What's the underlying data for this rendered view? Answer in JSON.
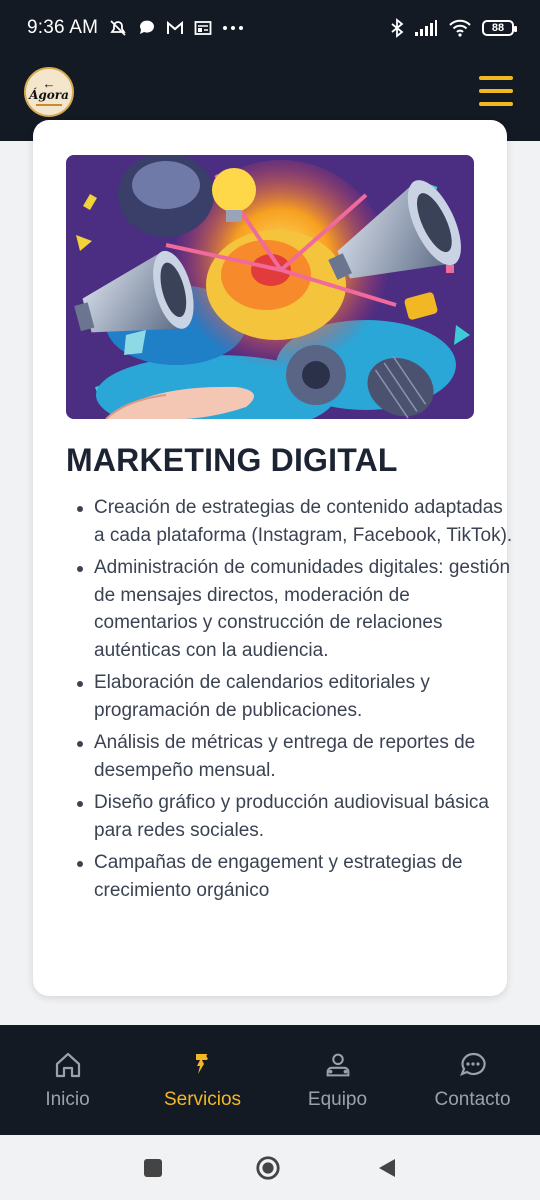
{
  "status_bar": {
    "time": "9:36 AM",
    "left_icons": [
      "mute-icon",
      "chat-bubble-icon",
      "gmail-icon",
      "news-icon",
      "more-dots-icon"
    ],
    "right_icons": [
      "bluetooth-icon",
      "signal-icon",
      "wifi-icon"
    ],
    "battery": "88"
  },
  "header": {
    "logo_text": "Ágora",
    "menu_icon": "hamburger-menu-icon",
    "accent_color": "#f2b824"
  },
  "card": {
    "image_icon": "marketing-megaphones-illustration",
    "title": "MARKETING DIGITAL",
    "features": [
      "Creación de estrategias de contenido adaptadas a cada plataforma (Instagram, Facebook, TikTok).",
      "Administración de comunidades digitales: gestión de mensajes directos, moderación de comentarios y construcción de relaciones auténticas con la audiencia.",
      "Elaboración de calendarios editoriales y programación de publicaciones.",
      "Análisis de métricas y entrega de reportes de desempeño mensual.",
      "Diseño gráfico y producción audiovisual básica para redes sociales.",
      "Campañas de engagement y estrategias de crecimiento orgánico"
    ]
  },
  "bottom_nav": {
    "items": [
      {
        "label": "Inicio",
        "icon": "home-icon",
        "active": false
      },
      {
        "label": "Servicios",
        "icon": "services-icon",
        "active": true
      },
      {
        "label": "Equipo",
        "icon": "team-icon",
        "active": false
      },
      {
        "label": "Contacto",
        "icon": "chat-icon",
        "active": false
      }
    ]
  },
  "system_nav": {
    "icons": [
      "recents-square-icon",
      "home-circle-icon",
      "back-triangle-icon"
    ]
  }
}
